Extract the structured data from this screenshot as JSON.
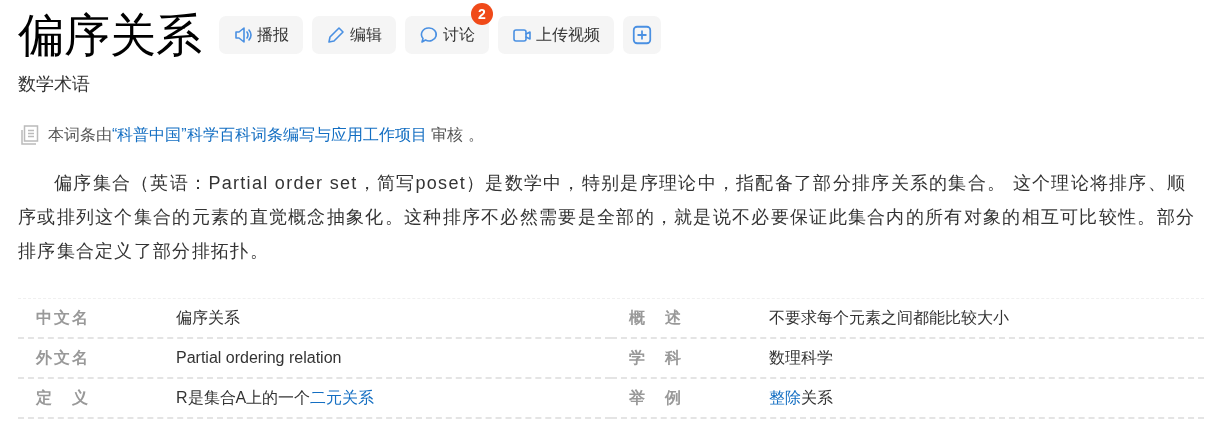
{
  "title": "偏序关系",
  "actions": [
    {
      "kind": "speaker",
      "label": "播报"
    },
    {
      "kind": "pencil",
      "label": "编辑"
    },
    {
      "kind": "chat",
      "label": "讨论",
      "badge": "2"
    },
    {
      "kind": "video",
      "label": "上传视频"
    },
    {
      "kind": "plus"
    }
  ],
  "subtitle": "数学术语",
  "review": {
    "before": "本词条由",
    "link": "“科普中国”科学百科词条编写与应用工作项目",
    "after": " 审核 。"
  },
  "summary": "偏序集合（英语：Partial order set，简写poset）是数学中，特别是序理论中，指配备了部分排序关系的集合。 这个理论将排序、顺序或排列这个集合的元素的直觉概念抽象化。这种排序不必然需要是全部的，就是说不必要保证此集合内的所有对象的相互可比较性。部分排序集合定义了部分排拓扑。",
  "info_rows": [
    {
      "label": "中文名",
      "value": [
        {
          "text": "偏序关系",
          "link": false
        }
      ],
      "label_2": "概述",
      "value_2": [
        {
          "text": "不要求每个元素之间都能比较大小",
          "link": false
        }
      ]
    },
    {
      "label": "外文名",
      "value": [
        {
          "text": "Partial ordering relation",
          "link": false
        }
      ],
      "label_2": "学科",
      "value_2": [
        {
          "text": "数理科学",
          "link": false
        }
      ]
    },
    {
      "label": "定义",
      "value": [
        {
          "text": "R是集合A上的一个",
          "link": false
        },
        {
          "text": "二元关系",
          "link": true
        }
      ],
      "label_2": "举例",
      "value_2": [
        {
          "text": "整除",
          "link": true
        },
        {
          "text": "关系",
          "link": false
        }
      ]
    }
  ]
}
